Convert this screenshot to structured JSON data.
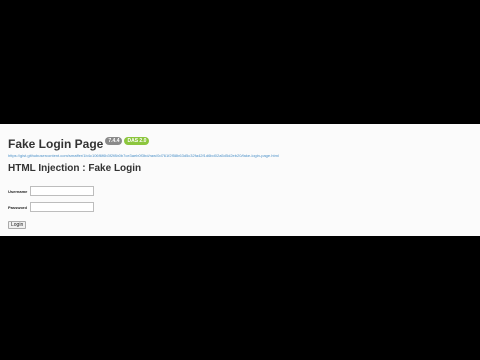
{
  "header": {
    "title": "Fake Login Page",
    "version_badge": "7.4.4",
    "tag_badge": "DAS 2.0",
    "url": "https://gist.githubusercontent.com/smaffer/1b4c106f6f6b3f2f8b0b7ce3aeb0f3bd/raw/0d761f2f58b63d5c32fa42f1d6bd02a5d5d2eb20/fake-login-page.html"
  },
  "main": {
    "section_title": "HTML Injection : Fake Login",
    "form": {
      "username_label": "Username",
      "username_value": "",
      "password_label": "Password",
      "password_value": "",
      "login_label": "Login"
    }
  },
  "colors": {
    "background": "#000000",
    "page": "#fbfbfb",
    "version_badge": "#8a8a8a",
    "tag_badge": "#8cc63e",
    "link": "#4a90c8"
  }
}
